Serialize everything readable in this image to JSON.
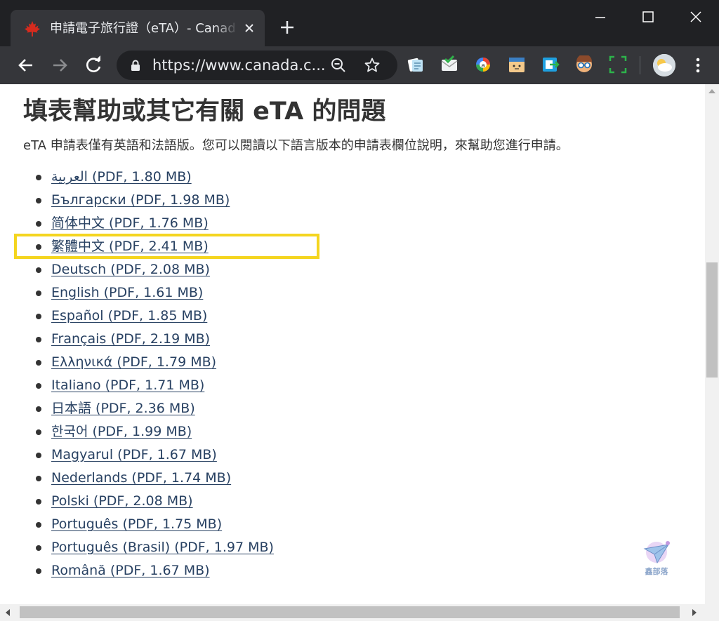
{
  "browser": {
    "tab": {
      "title": "申請電子旅行證（eTA）- Canada.ca",
      "favicon": "maple-leaf-icon"
    },
    "window_controls": [
      "minimize-icon",
      "maximize-icon",
      "close-icon"
    ],
    "url": {
      "scheme": "https://",
      "host": "www.canada.c...",
      "display": "https://www.canada.c..."
    },
    "extensions": [
      "note-extension-icon",
      "mail-extension-icon",
      "color-picker-extension-icon",
      "box-extension-icon",
      "share-extension-icon",
      "glasses-extension-icon",
      "screenshot-extension-icon"
    ]
  },
  "page": {
    "heading": "填表幫助或其它有關 eTA 的問題",
    "intro": "eTA 申請表僅有英語和法語版。您可以閱讀以下語言版本的申請表欄位說明，來幫助您進行申請。",
    "languages": [
      {
        "label": "العربية (PDF, 1.80 MB)"
      },
      {
        "label": "Български (PDF, 1.98 MB)"
      },
      {
        "label": "简体中文 (PDF, 1.76 MB)"
      },
      {
        "label": "繁體中文 (PDF, 2.41 MB)"
      },
      {
        "label": "Deutsch (PDF, 2.08 MB)"
      },
      {
        "label": "English (PDF, 1.61 MB)"
      },
      {
        "label": "Español (PDF, 1.85 MB)"
      },
      {
        "label": "Français (PDF, 2.19 MB)"
      },
      {
        "label": "Ελληνικά (PDF, 1.79 MB)"
      },
      {
        "label": "Italiano (PDF, 1.71 MB)"
      },
      {
        "label": "日本語 (PDF, 2.36 MB)"
      },
      {
        "label": "한국어 (PDF, 1.99 MB)"
      },
      {
        "label": "Magyarul (PDF, 1.67 MB)"
      },
      {
        "label": "Nederlands (PDF, 1.74 MB)"
      },
      {
        "label": "Polski (PDF, 2.08 MB)"
      },
      {
        "label": "Português (PDF, 1.75 MB)"
      },
      {
        "label": "Português (Brasil) (PDF, 1.97 MB)"
      },
      {
        "label": "Română (PDF, 1.67 MB)"
      }
    ],
    "highlighted_item": "繁體中文 (PDF, 2.41 MB)",
    "watermark": "鑫部落"
  },
  "colors": {
    "link": "#284162",
    "text": "#333333",
    "highlight": "#f4d51f",
    "chrome_dark": "#202124",
    "chrome_toolbar": "#35363a"
  }
}
